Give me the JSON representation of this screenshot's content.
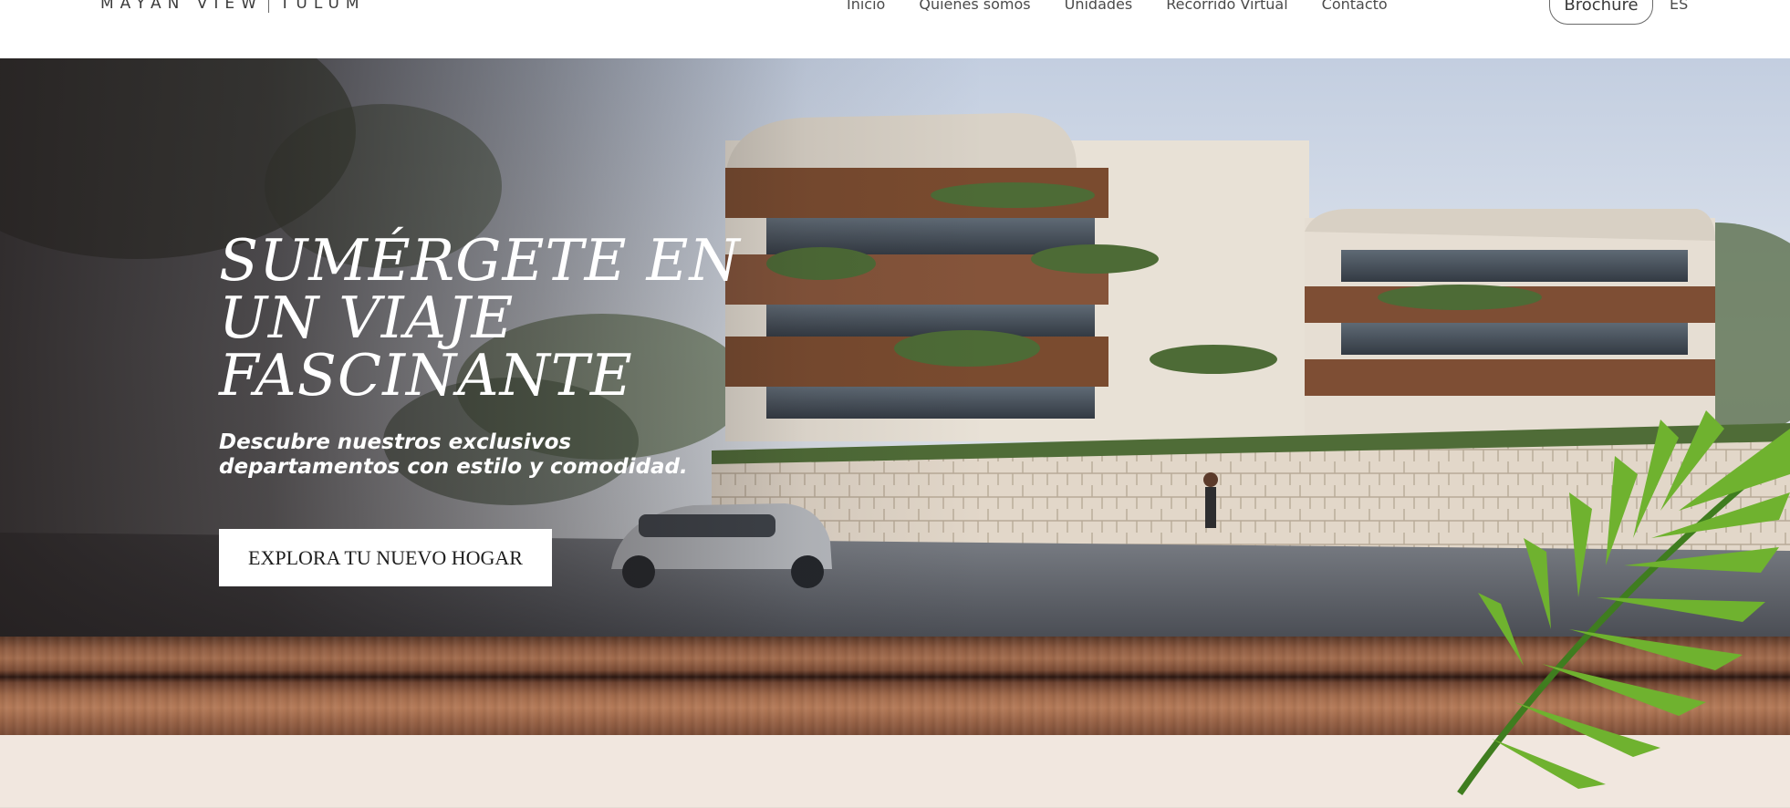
{
  "header": {
    "logo": {
      "left": "MAYAN VIEW",
      "right": "TULUM"
    },
    "nav": [
      {
        "label": "Inicio"
      },
      {
        "label": "Quiénes somos"
      },
      {
        "label": "Unidades"
      },
      {
        "label": "Recorrido Virtual"
      },
      {
        "label": "Contacto"
      }
    ],
    "brochure_label": "Brochure",
    "language": "ES"
  },
  "hero": {
    "title": "SUMÉRGETE EN UN VIAJE FASCINANTE",
    "subtitle": "Descubre nuestros exclusivos departamentos con estilo y comodidad.",
    "cta_label": "EXPLORA TU NUEVO HOGAR"
  },
  "colors": {
    "header_bg": "#ffffff",
    "text_dark": "#3b3b3b",
    "hero_text": "#ffffff",
    "cta_bg": "#ffffff",
    "bottom_bg": "#f1e7df"
  }
}
